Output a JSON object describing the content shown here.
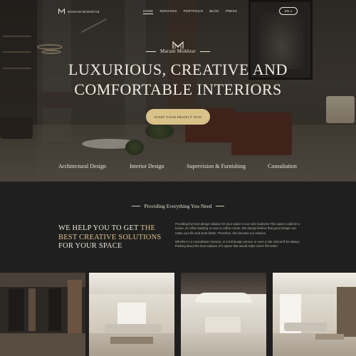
{
  "nav": {
    "brand": "MARAM MOKHTAR",
    "links": [
      {
        "label": "HOME",
        "active": true
      },
      {
        "label": "SERVICES",
        "active": false
      },
      {
        "label": "PORTFOLIO",
        "active": false
      },
      {
        "label": "BLOG",
        "active": false
      },
      {
        "label": "PRESS",
        "active": false
      }
    ],
    "language": "EN"
  },
  "hero": {
    "brand_name": "Maram Mokhtar",
    "title_line1": "LUXURIOUS, CREATIVE AND",
    "title_line2": "COMFORTABLE INTERIORS",
    "cta_label": "START YOUR PROJECT NOW",
    "services": [
      "Architectural Design",
      "Interior Design",
      "Supervision & Furnishing",
      "Consultation"
    ]
  },
  "about": {
    "section_heading": "Providing Everything You Need",
    "headline_part1": "WE HELP YOU TO GET ",
    "headline_highlight": "THE BEST CREATIVE SOLUTIONS",
    "headline_part2": " FOR YOUR SPACE",
    "paragraph1": "Providing the best design solution for your space is our core business This space could be a house, an office building or even a coffee corner. We deeply believe that good design can make your life and work better. Therefore, this became our mission",
    "paragraph2": "Whether in a consultation session, or a full design service or even a site visit we'll be always thinking about the best solution of a space that would make users' life better"
  },
  "colors": {
    "accent_gold": "#d9c28a",
    "background_dark": "#1f1f1f",
    "text_light": "#ece6db"
  },
  "icons": {
    "logo": "mm-monogram-icon",
    "language_caret": "chevron-down-icon"
  }
}
